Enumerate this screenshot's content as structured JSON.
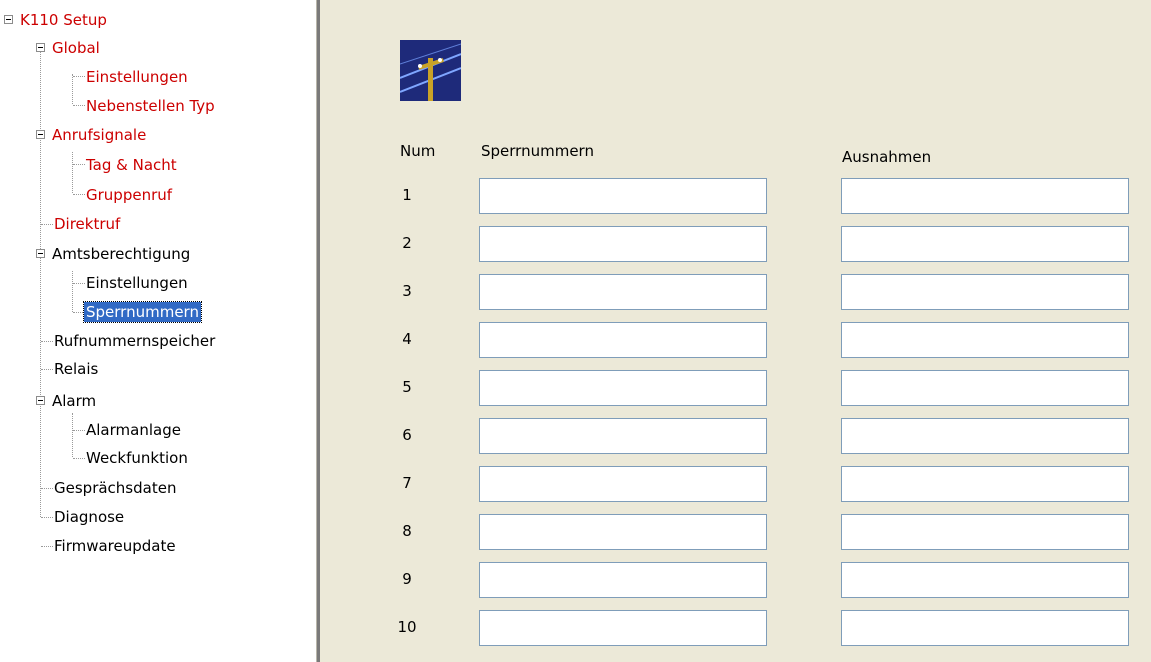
{
  "tree": {
    "root": "K110 Setup",
    "global": "Global",
    "global_einstellungen": "Einstellungen",
    "nebenstellen_typ": "Nebenstellen Typ",
    "anrufsignale": "Anrufsignale",
    "tag_nacht": "Tag & Nacht",
    "gruppenruf": "Gruppenruf",
    "direktruf": "Direktruf",
    "amtsberechtigung": "Amtsberechtigung",
    "amts_einstellungen": "Einstellungen",
    "sperrnummern": "Sperrnummern",
    "rufnummernspeicher": "Rufnummernspeicher",
    "relais": "Relais",
    "alarm": "Alarm",
    "alarmanlage": "Alarmanlage",
    "weckfunktion": "Weckfunktion",
    "gespraechsdaten": "Gesprächsdaten",
    "diagnose": "Diagnose",
    "firmwareupdate": "Firmwareupdate"
  },
  "colors": {
    "tree_red": "#cc0000",
    "selection": "#316ac5",
    "panel_bg": "#ece9d8",
    "field_border": "#7f9db9"
  },
  "form": {
    "icon": "telephone-pole-icon",
    "col_num": "Num",
    "col_sperr": "Sperrnummern",
    "col_ausnahmen": "Ausnahmen",
    "rows": [
      {
        "num": "1",
        "sperr": "",
        "ausnahme": ""
      },
      {
        "num": "2",
        "sperr": "",
        "ausnahme": ""
      },
      {
        "num": "3",
        "sperr": "",
        "ausnahme": ""
      },
      {
        "num": "4",
        "sperr": "",
        "ausnahme": ""
      },
      {
        "num": "5",
        "sperr": "",
        "ausnahme": ""
      },
      {
        "num": "6",
        "sperr": "",
        "ausnahme": ""
      },
      {
        "num": "7",
        "sperr": "",
        "ausnahme": ""
      },
      {
        "num": "8",
        "sperr": "",
        "ausnahme": ""
      },
      {
        "num": "9",
        "sperr": "",
        "ausnahme": ""
      },
      {
        "num": "10",
        "sperr": "",
        "ausnahme": ""
      }
    ]
  }
}
